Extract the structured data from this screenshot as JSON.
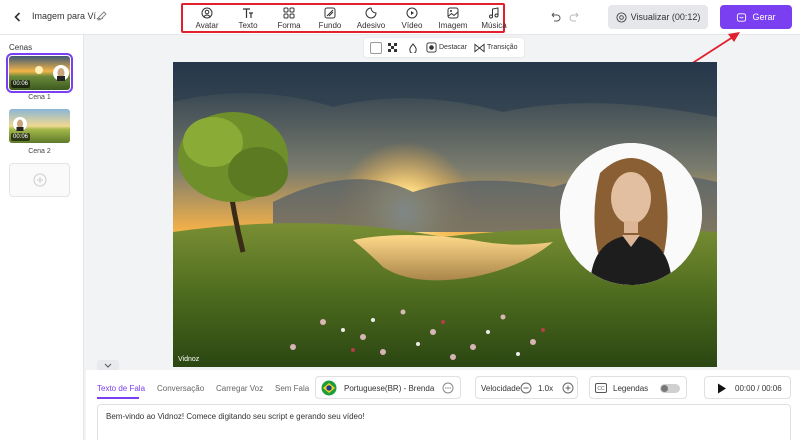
{
  "header": {
    "project_title": "Imagem para Ví...",
    "tools": [
      {
        "label": "Avatar",
        "icon": "avatar-icon"
      },
      {
        "label": "Texto",
        "icon": "text-icon"
      },
      {
        "label": "Forma",
        "icon": "shapes-icon"
      },
      {
        "label": "Fundo",
        "icon": "background-icon"
      },
      {
        "label": "Adesivo",
        "icon": "sticker-icon"
      },
      {
        "label": "Vídeo",
        "icon": "video-icon"
      },
      {
        "label": "Imagem",
        "icon": "image-icon"
      },
      {
        "label": "Música",
        "icon": "music-icon"
      }
    ],
    "preview_label": "Visualizar (00:12)",
    "generate_label": "Gerar"
  },
  "sidebar": {
    "title": "Cenas",
    "scenes": [
      {
        "name": "Cena 1",
        "duration": "00:06",
        "selected": true
      },
      {
        "name": "Cena 2",
        "duration": "00:06",
        "selected": false
      }
    ]
  },
  "subtoolbar": {
    "highlight_label": "Destacar",
    "transition_label": "Transição"
  },
  "canvas": {
    "watermark": "Vidnoz"
  },
  "bottom_panel": {
    "tabs": [
      {
        "label": "Texto de Fala",
        "active": true
      },
      {
        "label": "Conversação",
        "active": false
      },
      {
        "label": "Carregar Voz",
        "active": false
      },
      {
        "label": "Sem Fala",
        "active": false
      }
    ],
    "voice": "Portuguese(BR) - Brenda",
    "speed_label": "Velocidade",
    "speed_value": "1.0x",
    "subtitles_label": "Legendas",
    "playback_time": "00:00 / 00:06",
    "script_text": "Bem-vindo ao Vidnoz! Comece digitando seu script e gerando seu vídeo!"
  },
  "colors": {
    "accent": "#7b3ff2",
    "highlight_border": "#e0202c"
  }
}
